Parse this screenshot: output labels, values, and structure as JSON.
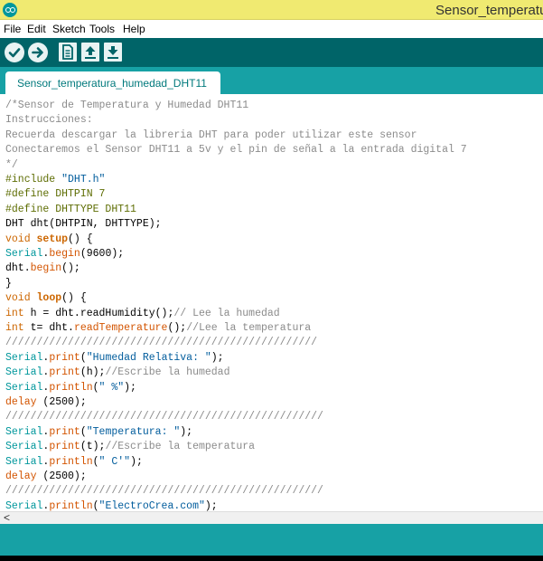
{
  "window": {
    "title": "Sensor_temperatur"
  },
  "menu": {
    "items": [
      "File",
      "Edit",
      "Sketch",
      "Tools",
      "Help"
    ]
  },
  "toolbar": {
    "buttons": [
      "verify-icon",
      "upload-icon",
      "new-icon",
      "open-icon",
      "save-icon"
    ]
  },
  "tabs": [
    {
      "label": "Sensor_temperatura_humedad_DHT11",
      "active": true
    }
  ],
  "editor": {
    "lines": [
      [
        [
          "cmt",
          "/*Sensor de Temperatura y Humedad DHT11"
        ]
      ],
      [
        [
          "cmt",
          "Instrucciones:"
        ]
      ],
      [
        [
          "cmt",
          "Recuerda descargar la libreria DHT para poder utilizar este sensor"
        ]
      ],
      [
        [
          "cmt",
          "Conectaremos el Sensor DHT11 a 5v y el pin de señal a la entrada digital 7"
        ]
      ],
      [
        [
          "cmt",
          "*/"
        ]
      ],
      [
        [
          "pre",
          "#include "
        ],
        [
          "str",
          "\"DHT.h\""
        ]
      ],
      [
        [
          "pre",
          "#define DHTPIN 7"
        ]
      ],
      [
        [
          "pre",
          "#define DHTTYPE DHT11"
        ]
      ],
      [
        [
          "txt",
          "DHT dht(DHTPIN, DHTTYPE);"
        ]
      ],
      [
        [
          "kw",
          "void "
        ],
        [
          "kwb",
          "setup"
        ],
        [
          "txt",
          "() {"
        ]
      ],
      [
        [
          "ty",
          "Serial"
        ],
        [
          "txt",
          "."
        ],
        [
          "fn",
          "begin"
        ],
        [
          "txt",
          "(9600);"
        ]
      ],
      [
        [
          "txt",
          "dht."
        ],
        [
          "fn",
          "begin"
        ],
        [
          "txt",
          "();"
        ]
      ],
      [
        [
          "txt",
          "}"
        ]
      ],
      [
        [
          "kw",
          "void "
        ],
        [
          "kwb",
          "loop"
        ],
        [
          "txt",
          "() {"
        ]
      ],
      [
        [
          "kw",
          "int"
        ],
        [
          "txt",
          " h = dht.readHumidity();"
        ],
        [
          "cmt",
          "// Lee la humedad"
        ]
      ],
      [
        [
          "kw",
          "int"
        ],
        [
          "txt",
          " t= dht."
        ],
        [
          "fn",
          "readTemperature"
        ],
        [
          "txt",
          "();"
        ],
        [
          "cmt",
          "//Lee la temperatura"
        ]
      ],
      [
        [
          "cmt",
          "//////////////////////////////////////////////////"
        ]
      ],
      [
        [
          "ty",
          "Serial"
        ],
        [
          "txt",
          "."
        ],
        [
          "fn",
          "print"
        ],
        [
          "txt",
          "("
        ],
        [
          "str",
          "\"Humedad Relativa: \""
        ],
        [
          "txt",
          ");"
        ]
      ],
      [
        [
          "ty",
          "Serial"
        ],
        [
          "txt",
          "."
        ],
        [
          "fn",
          "print"
        ],
        [
          "txt",
          "(h);"
        ],
        [
          "cmt",
          "//Escribe la humedad"
        ]
      ],
      [
        [
          "ty",
          "Serial"
        ],
        [
          "txt",
          "."
        ],
        [
          "fn",
          "println"
        ],
        [
          "txt",
          "("
        ],
        [
          "str",
          "\" %\""
        ],
        [
          "txt",
          ");"
        ]
      ],
      [
        [
          "fn",
          "delay"
        ],
        [
          "txt",
          " (2500);"
        ]
      ],
      [
        [
          "cmt",
          "///////////////////////////////////////////////////"
        ]
      ],
      [
        [
          "ty",
          "Serial"
        ],
        [
          "txt",
          "."
        ],
        [
          "fn",
          "print"
        ],
        [
          "txt",
          "("
        ],
        [
          "str",
          "\"Temperatura: \""
        ],
        [
          "txt",
          ");"
        ]
      ],
      [
        [
          "ty",
          "Serial"
        ],
        [
          "txt",
          "."
        ],
        [
          "fn",
          "print"
        ],
        [
          "txt",
          "(t);"
        ],
        [
          "cmt",
          "//Escribe la temperatura"
        ]
      ],
      [
        [
          "ty",
          "Serial"
        ],
        [
          "txt",
          "."
        ],
        [
          "fn",
          "println"
        ],
        [
          "txt",
          "("
        ],
        [
          "str",
          "\" C'\""
        ],
        [
          "txt",
          ");"
        ]
      ],
      [
        [
          "fn",
          "delay"
        ],
        [
          "txt",
          " (2500);"
        ]
      ],
      [
        [
          "cmt",
          "///////////////////////////////////////////////////"
        ]
      ],
      [
        [
          "ty",
          "Serial"
        ],
        [
          "txt",
          "."
        ],
        [
          "fn",
          "println"
        ],
        [
          "txt",
          "("
        ],
        [
          "str",
          "\"ElectroCrea.com\""
        ],
        [
          "txt",
          ");"
        ]
      ]
    ]
  },
  "scrollbar": {
    "left_arrow": "<"
  },
  "colors": {
    "title_bar": "#f0ea71",
    "toolbar": "#006468",
    "tab_bar": "#17a1a5",
    "tab_text": "#00797c",
    "comment": "#8b8b8b",
    "keyword": "#cc6600",
    "type": "#00979c",
    "string": "#005c9c"
  }
}
